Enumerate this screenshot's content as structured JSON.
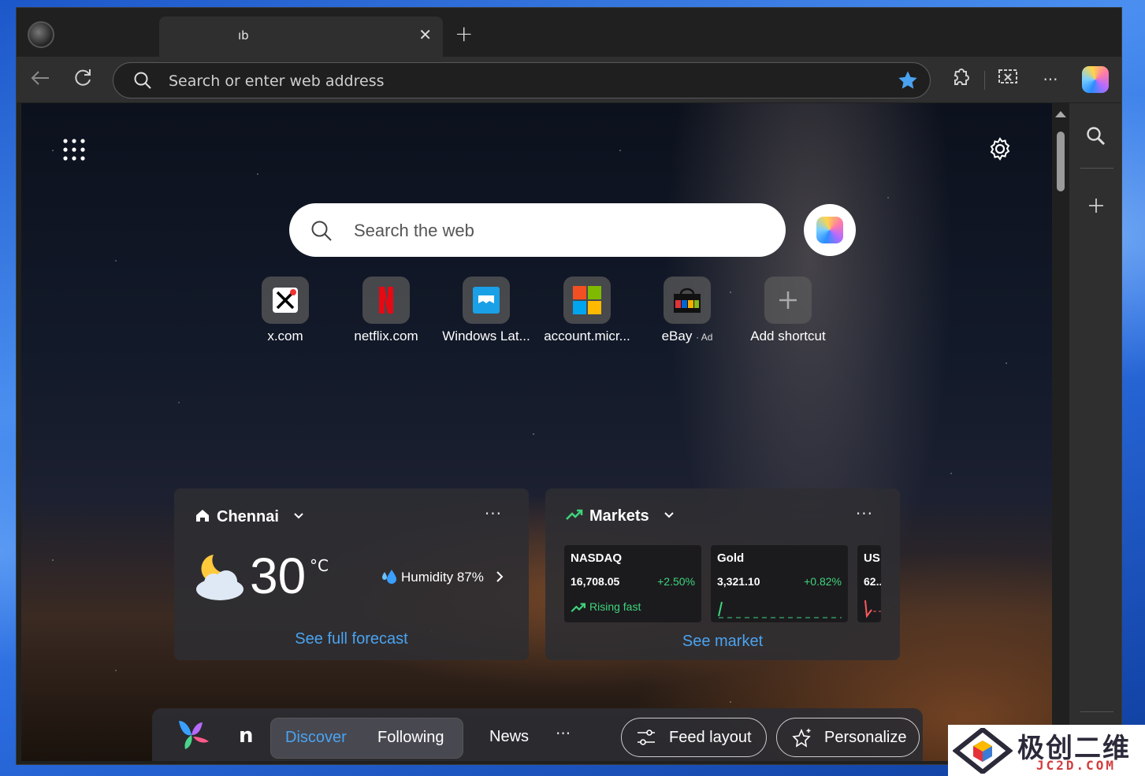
{
  "browser": {
    "tab_title": "ıb",
    "tab_close": "✕",
    "new_tab": "+",
    "address_placeholder": "Search or enter web address",
    "toolbar_more": "···"
  },
  "newtab": {
    "search_placeholder": "Search the web",
    "shortcuts": [
      {
        "label": "x.com",
        "icon": "x-logo-icon"
      },
      {
        "label": "netflix.com",
        "icon": "netflix-logo-icon"
      },
      {
        "label": "Windows Lat...",
        "icon": "windows-latest-icon"
      },
      {
        "label": "account.micr...",
        "icon": "microsoft-logo-icon"
      },
      {
        "label": "eBay",
        "ad": "· Ad",
        "icon": "ebay-bag-icon"
      },
      {
        "label": "Add shortcut",
        "icon": "plus-icon"
      }
    ]
  },
  "weather": {
    "city": "Chennai",
    "temperature": "30",
    "unit": "°C",
    "humidity": "Humidity 87%",
    "link": "See full forecast",
    "more": "···"
  },
  "markets": {
    "title": "Markets",
    "more": "···",
    "link": "See market",
    "stocks": [
      {
        "name": "NASDAQ",
        "value": "16,708.05",
        "change": "+2.50%",
        "trend": "Rising fast"
      },
      {
        "name": "Gold",
        "value": "3,321.10",
        "change": "+0.82%"
      },
      {
        "name": "US",
        "value": "62.."
      }
    ]
  },
  "feed": {
    "partial": "n",
    "discover": "Discover",
    "following": "Following",
    "news": "News",
    "more": "···",
    "feed_layout": "Feed layout",
    "personalize": "Personalize"
  },
  "watermark": {
    "text": "极创二维",
    "sub": "JC2D.COM"
  },
  "colors": {
    "accent": "#4aa3f0",
    "positive": "#3fd47a",
    "chrome": "#202020",
    "toolbar": "#2f2f2f"
  }
}
